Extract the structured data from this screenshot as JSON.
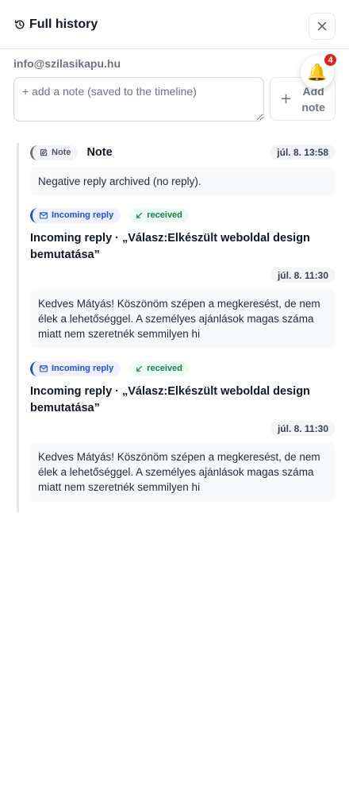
{
  "header": {
    "title": "Full history",
    "history_icon": "history-icon",
    "close_icon": "close-icon"
  },
  "contact": {
    "email": "info@szilasikapu.hu"
  },
  "notifications": {
    "icon": "bell-icon",
    "count": "4"
  },
  "note_form": {
    "placeholder": "+ add a note (saved to the timeline)",
    "value": "",
    "add_button_label": "Add note"
  },
  "timeline": {
    "entries": [
      {
        "type_label": "Note",
        "title": "Note",
        "time": "júl. 8. 13:58",
        "body": "Negative reply archived (no reply)."
      },
      {
        "type_label": "Incoming reply",
        "status_label": "received",
        "title": "Incoming reply · „Válasz:Elkészült weboldal design bemutatása”",
        "time": "júl. 8. 11:30",
        "body": "Kedves Mátyás! Köszönöm szépen a megkeresést, de nem élek a lehetőséggel. A személyes ajánlások magas száma miatt nem szeretnék semmilyen hi"
      },
      {
        "type_label": "Incoming reply",
        "status_label": "received",
        "title": "Incoming reply · „Válasz:Elkészült weboldal design bemutatása”",
        "time": "júl. 8. 11:30",
        "body": "Kedves Mátyás! Köszönöm szépen a megkeresést, de nem élek a lehetőséggel. A személyes ajánlások magas száma miatt nem szeretnék semmilyen hi"
      }
    ]
  },
  "colors": {
    "accent": "#1d4ed8",
    "received": "#15803d",
    "badge": "#dc2626"
  }
}
